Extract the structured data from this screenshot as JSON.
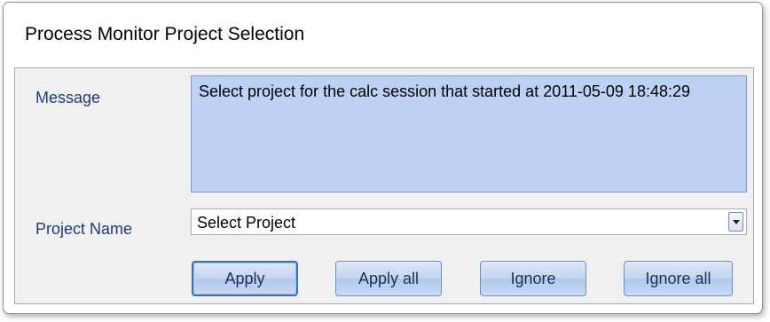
{
  "window": {
    "title": "Process Monitor Project Selection"
  },
  "message": {
    "label": "Message",
    "text": "Select project for the calc session that started at 2011-05-09 18:48:29"
  },
  "project": {
    "label": "Project Name",
    "selected": "Select Project"
  },
  "buttons": {
    "apply": "Apply",
    "apply_all": "Apply all",
    "ignore": "Ignore",
    "ignore_all": "Ignore all"
  },
  "colors": {
    "message_background": "#bcd1f4",
    "label_text": "#1e3a7c"
  }
}
